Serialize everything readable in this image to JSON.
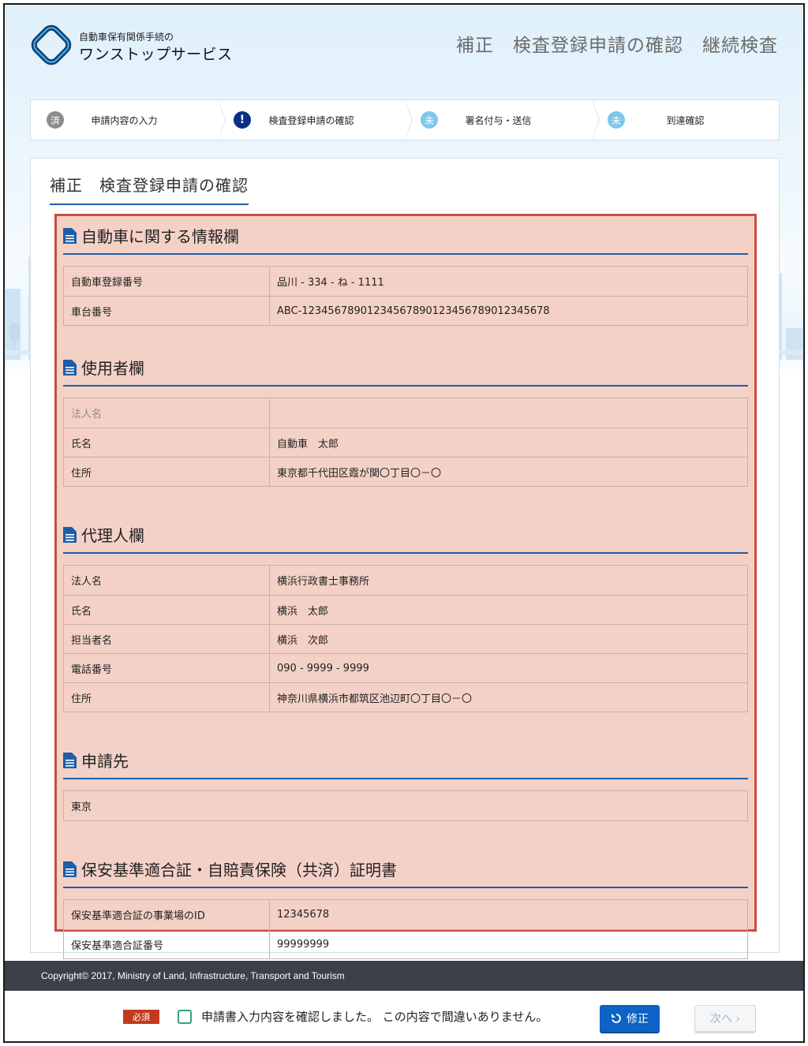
{
  "header": {
    "logo_sub": "自動車保有関係手続の",
    "logo_main": "ワンストップサービス",
    "page_heading": "補正　検査登録申請の確認　継続検査"
  },
  "stepper": [
    {
      "badge": "済",
      "label": "申請内容の入力",
      "state": "done"
    },
    {
      "badge": "!",
      "label": "検査登録申請の確認",
      "state": "current"
    },
    {
      "badge": "未",
      "label": "署名付与・送信",
      "state": "todo"
    },
    {
      "badge": "未",
      "label": "到達確認",
      "state": "todo"
    }
  ],
  "panel": {
    "title": "補正　検査登録申請の確認"
  },
  "sections": {
    "vehicle": {
      "title": "自動車に関する情報欄",
      "rows": [
        {
          "label": "自動車登録番号",
          "value": "品川 - 334 - ね - 1111"
        },
        {
          "label": "車台番号",
          "value": "ABC-1234567890123456789012345678901234 5678"
        }
      ]
    },
    "user": {
      "title": "使用者欄",
      "rows": [
        {
          "label": "法人名",
          "value": ""
        },
        {
          "label": "氏名",
          "value": "自動車　太郎"
        },
        {
          "label": "住所",
          "value": "東京都千代田区霞が関〇丁目〇－〇"
        }
      ]
    },
    "agent": {
      "title": "代理人欄",
      "rows": [
        {
          "label": "法人名",
          "value": "横浜行政書士事務所"
        },
        {
          "label": "氏名",
          "value": "横浜　太郎"
        },
        {
          "label": "担当者名",
          "value": "横浜　次郎"
        },
        {
          "label": "電話番号",
          "value": "090 - 9999 - 9999"
        },
        {
          "label": "住所",
          "value": "神奈川県横浜市都筑区池辺町〇丁目〇－〇"
        }
      ]
    },
    "destination": {
      "title": "申請先",
      "value": "東京"
    },
    "certificate": {
      "title": "保安基準適合証・自賠責保険（共済）証明書",
      "rows": [
        {
          "label": "保安基準適合証の事業場のID",
          "value": "12345678"
        },
        {
          "label": "保安基準適合証番号",
          "value": "99999999"
        }
      ]
    }
  },
  "footer": {
    "copyright": "Copyright© 2017, Ministry of Land, Infrastructure, Transport and Tourism",
    "required_label": "必須",
    "confirm_text": "申請書入力内容を確認しました。 この内容で間違いありません。",
    "fix_button": "修正",
    "next_button": "次へ ›"
  },
  "colors": {
    "accent_blue": "#1d5ea8",
    "highlight_border": "#c94c43",
    "highlight_fill": "#f0cdc3",
    "required_red": "#c23a1e",
    "fix_button_blue": "#0d63c6"
  }
}
